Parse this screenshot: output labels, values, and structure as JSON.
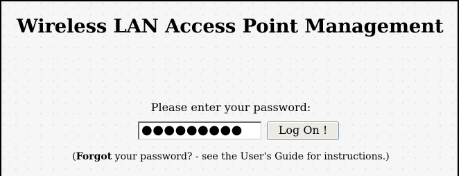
{
  "page": {
    "title": "Wireless LAN Access Point Management"
  },
  "login": {
    "prompt": "Please enter your password:",
    "password_masked": "●●●●●●●●●",
    "button_label": "Log On !"
  },
  "help": {
    "open_paren": "(",
    "forgot_link": "Forgot",
    "rest": " your password? - see the User's Guide for instructions.)"
  }
}
